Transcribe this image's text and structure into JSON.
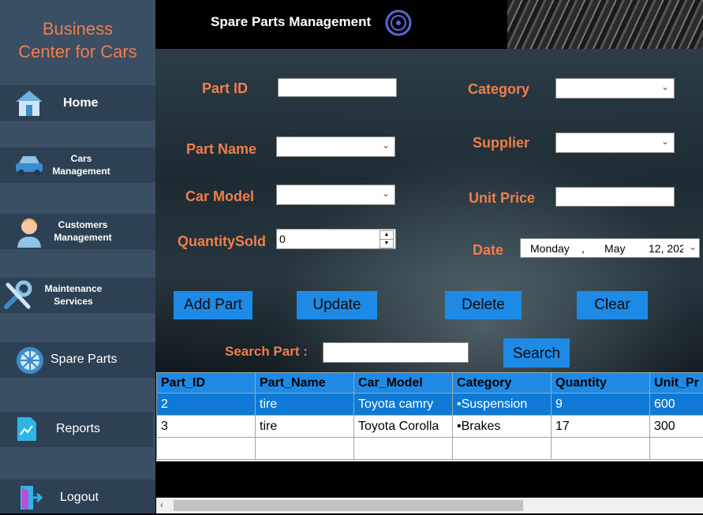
{
  "sidebar": {
    "brand_line1": "Business",
    "brand_line2": "Center for Cars",
    "items": [
      {
        "label": "Home",
        "icon": "home-icon"
      },
      {
        "label": "Cars Management",
        "icon": "car-icon"
      },
      {
        "label": "Customers Management",
        "icon": "user-icon"
      },
      {
        "label": "Maintenance Services",
        "icon": "tools-icon"
      },
      {
        "label": "Spare Parts",
        "icon": "wheel-icon"
      },
      {
        "label": "Reports",
        "icon": "report-icon"
      },
      {
        "label": "Logout",
        "icon": "logout-icon"
      }
    ]
  },
  "header": {
    "title": "Spare Parts Management"
  },
  "form": {
    "part_id_label": "Part ID",
    "part_name_label": "Part Name",
    "car_model_label": "Car Model",
    "quantity_sold_label": "QuantitySold",
    "quantity_sold_value": "0",
    "category_label": "Category",
    "supplier_label": "Supplier",
    "unit_price_label": "Unit Price",
    "date_label": "Date",
    "date_day": "Monday",
    "date_sep": ",",
    "date_month": "May",
    "date_daynum": "12, 202",
    "search_label": "Search Part :"
  },
  "buttons": {
    "add": "Add Part",
    "update": "Update",
    "delete": "Delete",
    "clear": "Clear",
    "search": "Search"
  },
  "grid": {
    "columns": [
      "Part_ID",
      "Part_Name",
      "Car_Model",
      "Category",
      "Quantity",
      "Unit_Pr"
    ],
    "rows": [
      [
        "2",
        "tire",
        "Toyota camry",
        "•Suspension",
        "9",
        "600"
      ],
      [
        "3",
        "tire",
        "Toyota Corolla",
        "•Brakes",
        "17",
        "300"
      ]
    ]
  },
  "colors": {
    "accent": "#f07e4d",
    "button": "#1e8ae6",
    "sidebar": "#3a4e64"
  }
}
